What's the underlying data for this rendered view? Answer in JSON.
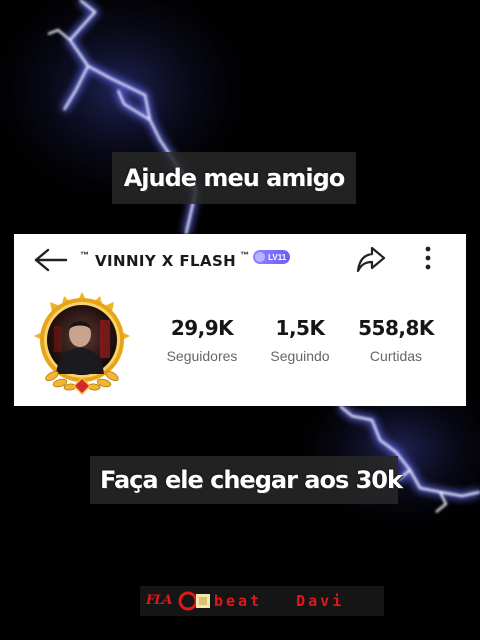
{
  "overlay": {
    "caption_top": "Ajude meu amigo",
    "caption_bottom": "Faça ele chegar aos 30k"
  },
  "profile": {
    "username": "VINNIY X FLASH",
    "tm_left": "™",
    "tm_right": "™",
    "level_badge": "LV11",
    "stats": {
      "followers": {
        "value": "29,9K",
        "label": "Seguidores"
      },
      "following": {
        "value": "1,5K",
        "label": "Seguindo"
      },
      "likes": {
        "value": "558,8K",
        "label": "Curtidas"
      }
    }
  },
  "watermark": {
    "logo_text": "FLA",
    "word1": "beat",
    "word2": "Davi"
  },
  "icons": {
    "back": "arrow-left-icon",
    "share": "share-arrow-icon",
    "more": "vertical-dots-icon",
    "level": "level-badge-icon",
    "avatar_frame": "gold-laurel-frame"
  },
  "colors": {
    "background": "#000000",
    "lightning": "#e6e8ff",
    "card": "#ffffff",
    "level_badge": "#7a6cf7",
    "watermark_red": "#e01818",
    "avatar_frame_gold": "#e8a317"
  }
}
